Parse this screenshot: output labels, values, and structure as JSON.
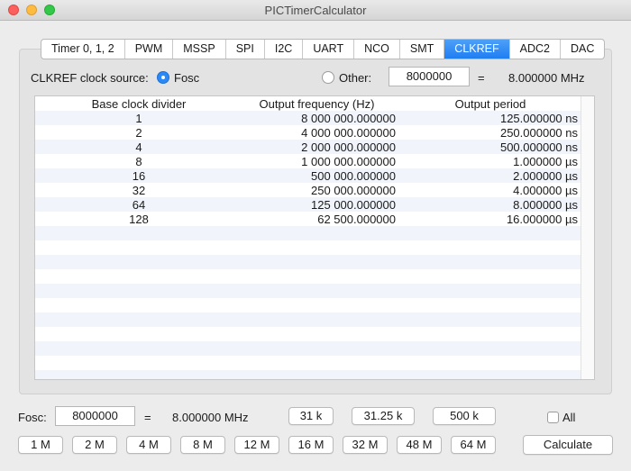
{
  "window": {
    "title": "PICTimerCalculator"
  },
  "tabs": [
    {
      "label": "Timer 0, 1, 2"
    },
    {
      "label": "PWM"
    },
    {
      "label": "MSSP"
    },
    {
      "label": "SPI"
    },
    {
      "label": "I2C"
    },
    {
      "label": "UART"
    },
    {
      "label": "NCO"
    },
    {
      "label": "SMT"
    },
    {
      "label": "CLKREF",
      "active": true
    },
    {
      "label": "ADC2"
    },
    {
      "label": "DAC"
    }
  ],
  "clkref": {
    "source_label": "CLKREF clock source:",
    "fosc_label": "Fosc",
    "other_label": "Other:",
    "other_value": "8000000",
    "equals": "=",
    "other_mhz": "8.000000 MHz",
    "selected": "Fosc"
  },
  "table": {
    "headers": [
      "Base clock divider",
      "Output frequency (Hz)",
      "Output period"
    ],
    "rows": [
      {
        "divider": "1",
        "freq": "8 000 000.000000",
        "period": "125.000000 ns"
      },
      {
        "divider": "2",
        "freq": "4 000 000.000000",
        "period": "250.000000 ns"
      },
      {
        "divider": "4",
        "freq": "2 000 000.000000",
        "period": "500.000000 ns"
      },
      {
        "divider": "8",
        "freq": "1 000 000.000000",
        "period": "1.000000 µs"
      },
      {
        "divider": "16",
        "freq": "500 000.000000",
        "period": "2.000000 µs"
      },
      {
        "divider": "32",
        "freq": "250 000.000000",
        "period": "4.000000 µs"
      },
      {
        "divider": "64",
        "freq": "125 000.000000",
        "period": "8.000000 µs"
      },
      {
        "divider": "128",
        "freq": "62 500.000000",
        "period": "16.000000 µs"
      }
    ]
  },
  "bottom": {
    "fosc_label": "Fosc:",
    "fosc_value": "8000000",
    "equals": "=",
    "fosc_mhz": "8.000000 MHz",
    "quick_buttons_row1": [
      "31 k",
      "31.25 k",
      "500 k"
    ],
    "quick_buttons_row2": [
      "1 M",
      "2 M",
      "4 M",
      "8 M",
      "12 M",
      "16 M",
      "32 M",
      "48 M",
      "64 M"
    ],
    "all_label": "All",
    "all_checked": false,
    "calculate_label": "Calculate"
  }
}
